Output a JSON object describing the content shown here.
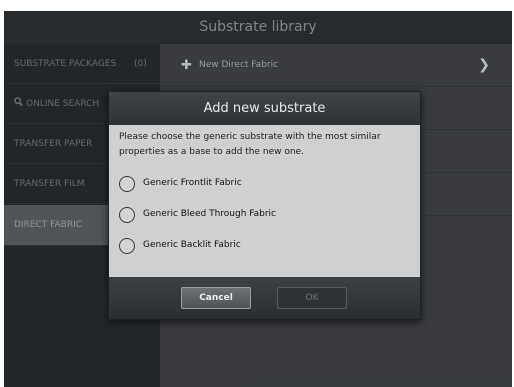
{
  "window": {
    "title": "Substrate library"
  },
  "sidebar": {
    "items": [
      {
        "label": "SUBSTRATE PACKAGES",
        "count": "(0)"
      },
      {
        "label": "ONLINE SEARCH",
        "icon": "search-icon"
      },
      {
        "label": "TRANSFER PAPER"
      },
      {
        "label": "TRANSFER FILM"
      },
      {
        "label": "DIRECT FABRIC",
        "selected": true
      }
    ]
  },
  "content": {
    "new_item_label": "New Direct Fabric",
    "new_item_icon": "plus-icon",
    "chevron_icon": "chevron-right-icon"
  },
  "dialog": {
    "title": "Add new substrate",
    "message": "Please choose the generic substrate with the most similar properties as a base to add the new one.",
    "options": [
      {
        "label": "Generic Frontlit Fabric",
        "selected": false
      },
      {
        "label": "Generic Bleed Through Fabric",
        "selected": false
      },
      {
        "label": "Generic Backlit Fabric",
        "selected": false
      }
    ],
    "cancel_label": "Cancel",
    "ok_label": "OK"
  },
  "colors": {
    "background": "#3d4042",
    "sidebar": "#262a2d",
    "selected_item": "#585c60",
    "dialog_body": "#cfd0d1",
    "dialog_header": "#2f3336"
  }
}
